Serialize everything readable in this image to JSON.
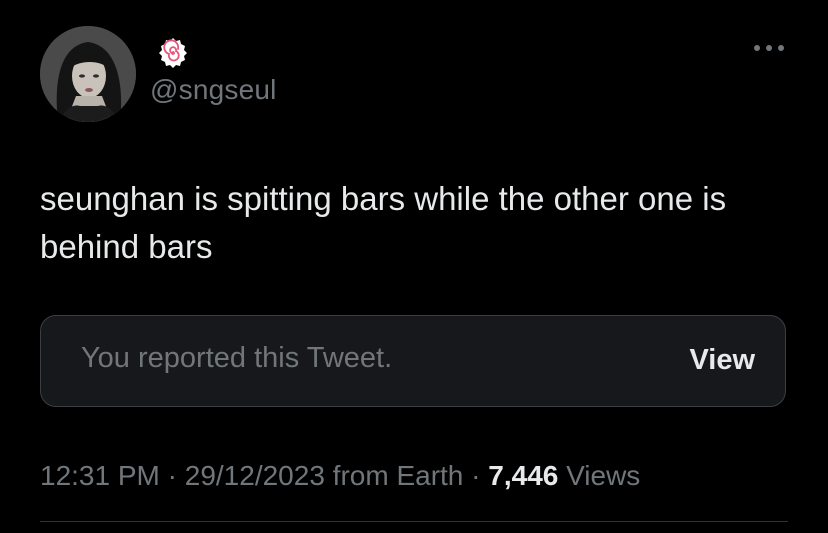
{
  "user": {
    "handle": "@sngseul",
    "name_icon": "fishcake-swirl-emoji",
    "avatar_icon": "profile-photo"
  },
  "header": {
    "more_icon": "more-horizontal-icon"
  },
  "tweet": {
    "text": "seunghan is spitting bars while the other one is behind bars"
  },
  "notice": {
    "message": "You reported this Tweet.",
    "view_label": "View"
  },
  "meta": {
    "time": "12:31 PM",
    "sep1": " · ",
    "date": "29/12/2023",
    "source": " from Earth",
    "sep2": " · ",
    "views_count": "7,446",
    "views_label": " Views"
  },
  "colors": {
    "background": "#000000",
    "text_primary": "#e7e9ea",
    "text_secondary": "#71767b",
    "notice_bg": "#16181c",
    "notice_border": "#3b3f44"
  }
}
